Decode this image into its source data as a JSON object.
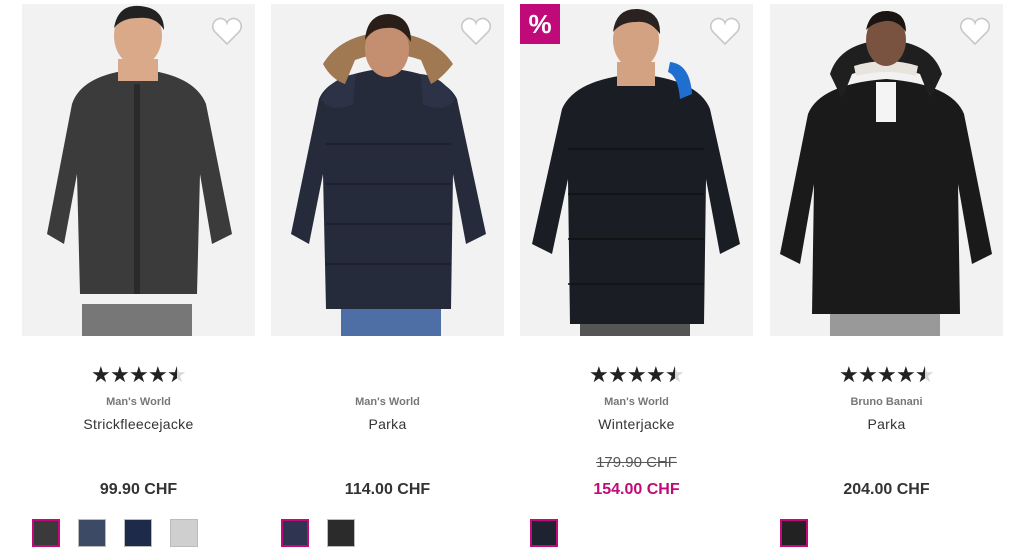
{
  "colors": {
    "accent": "#c10a7a",
    "text": "#333333",
    "muted": "#777777"
  },
  "products": [
    {
      "brand": "Man's World",
      "name": "Strickfleecejacke",
      "price": "99.90 CHF",
      "old_price": "",
      "rating": 4.5,
      "sale": false,
      "swatch_colors": [
        "#3a3a3a",
        "#3d4a66",
        "#1e2a4a",
        "#cfcfcf"
      ],
      "selected_swatch": 0,
      "garment_color": "#3b3b3b"
    },
    {
      "brand": "Man's World",
      "name": "Parka",
      "price": "114.00 CHF",
      "old_price": "",
      "rating": null,
      "sale": false,
      "swatch_colors": [
        "#2f3550",
        "#2b2b2b"
      ],
      "selected_swatch": 0,
      "garment_color": "#262b3c"
    },
    {
      "brand": "Man's World",
      "name": "Winterjacke",
      "price": "154.00 CHF",
      "old_price": "179.90 CHF",
      "rating": 4.5,
      "sale": true,
      "sale_badge": "%",
      "swatch_colors": [
        "#1f2230"
      ],
      "selected_swatch": 0,
      "garment_color": "#1b1d24"
    },
    {
      "brand": "Bruno Banani",
      "name": "Parka",
      "price": "204.00 CHF",
      "old_price": "",
      "rating": 4.5,
      "sale": false,
      "swatch_colors": [
        "#222222"
      ],
      "selected_swatch": 0,
      "garment_color": "#1a1a1a"
    }
  ]
}
